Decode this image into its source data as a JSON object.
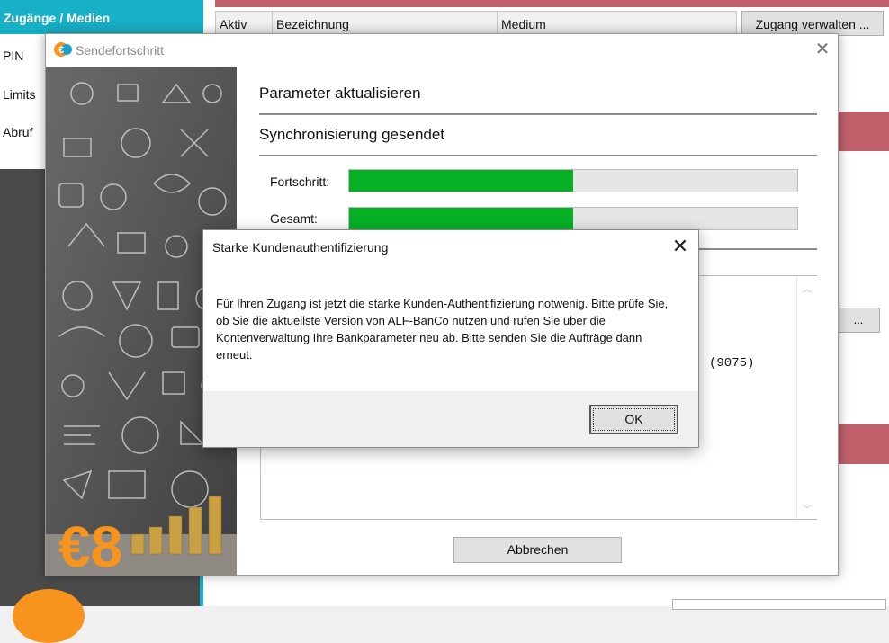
{
  "background_app": {
    "sidebar_title": "Zugänge / Medien",
    "sidebar_items": [
      "PIN",
      "Limits",
      "Abruf"
    ],
    "table_headers": [
      "Aktiv",
      "Bezeichnung",
      "Medium"
    ],
    "manage_button": "Zugang verwalten ...",
    "dots_button": "..."
  },
  "send_dialog": {
    "title": "Sendefortschritt",
    "steps": [
      "Parameter aktualisieren",
      "Synchronisierung gesendet"
    ],
    "progress_label": "Fortschritt:",
    "progress_value": 0.5,
    "total_label": "Gesamt:",
    "total_value": 0.5,
    "log_text": "(9075)",
    "cancel_button": "Abbrechen",
    "logo_text": "€8"
  },
  "sca_dialog": {
    "title": "Starke Kundenauthentifizierung",
    "message": "Für Ihren Zugang ist jetzt die starke Kunden-Authentifizierung notwenig. Bitte prüfe Sie, ob Sie die aktuellste Version von ALF-BanCo nutzen und rufen Sie über die Kontenverwaltung Ihre Bankparameter neu ab. Bitte senden Sie die Aufträge dann erneut.",
    "ok_button": "OK",
    "close_icon": "close-icon"
  },
  "colors": {
    "accent_teal": "#17b0c7",
    "progress_green": "#06b025",
    "brand_orange": "#f7941d",
    "brand_blue": "#1ba1c9",
    "header_red": "#c0606a"
  }
}
